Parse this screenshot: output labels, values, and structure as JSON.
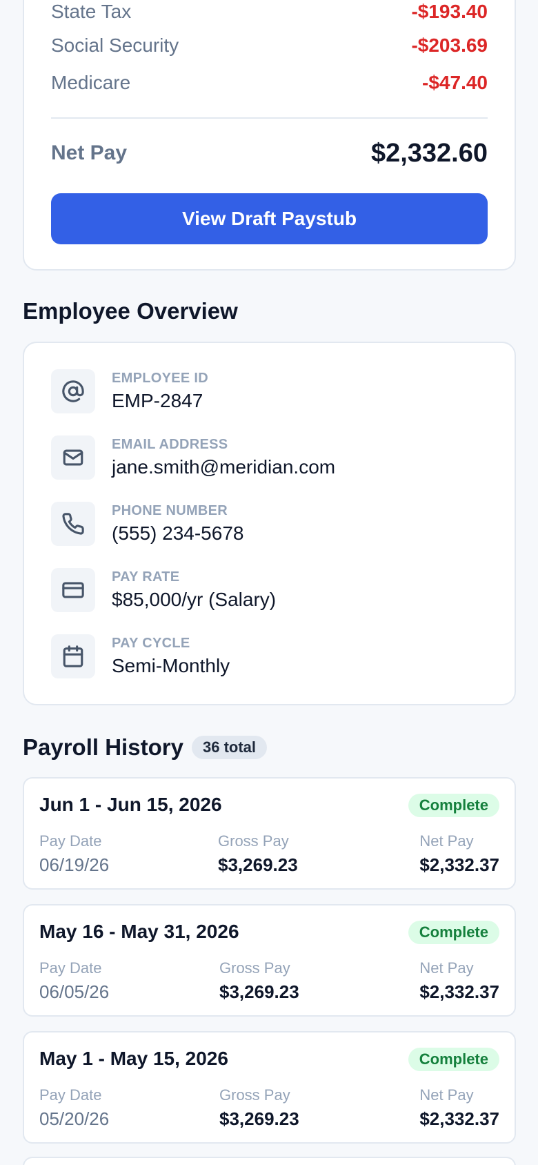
{
  "summary": {
    "deductions": [
      {
        "label": "State Tax",
        "amount": "-$193.40"
      },
      {
        "label": "Social Security",
        "amount": "-$203.69"
      },
      {
        "label": "Medicare",
        "amount": "-$47.40"
      }
    ],
    "net_pay_label": "Net Pay",
    "net_pay_amount": "$2,332.60",
    "draft_button_label": "View Draft Paystub"
  },
  "overview": {
    "title": "Employee Overview",
    "items": [
      {
        "label": "EMPLOYEE ID",
        "value": "EMP-2847",
        "icon": "at-icon"
      },
      {
        "label": "EMAIL ADDRESS",
        "value": "jane.smith@meridian.com",
        "icon": "mail-icon"
      },
      {
        "label": "PHONE NUMBER",
        "value": "(555) 234-5678",
        "icon": "phone-icon"
      },
      {
        "label": "PAY RATE",
        "value": "$85,000/yr (Salary)",
        "icon": "credit-card-icon"
      },
      {
        "label": "PAY CYCLE",
        "value": "Semi-Monthly",
        "icon": "calendar-icon"
      }
    ]
  },
  "history": {
    "title": "Payroll History",
    "count": "36 total",
    "col_pay_date": "Pay Date",
    "col_gross": "Gross Pay",
    "col_net": "Net Pay",
    "entries": [
      {
        "period": "Jun 1 - Jun 15, 2026",
        "status": "Complete",
        "pay_date": "06/19/26",
        "gross": "$3,269.23",
        "net": "$2,332.37"
      },
      {
        "period": "May 16 - May 31, 2026",
        "status": "Complete",
        "pay_date": "06/05/26",
        "gross": "$3,269.23",
        "net": "$2,332.37"
      },
      {
        "period": "May 1 - May 15, 2026",
        "status": "Complete",
        "pay_date": "05/20/26",
        "gross": "$3,269.23",
        "net": "$2,332.37"
      }
    ]
  },
  "colors": {
    "accent": "#3360e6",
    "negative": "#dc2626",
    "success_bg": "#dcfce7",
    "success_text": "#15803d"
  }
}
